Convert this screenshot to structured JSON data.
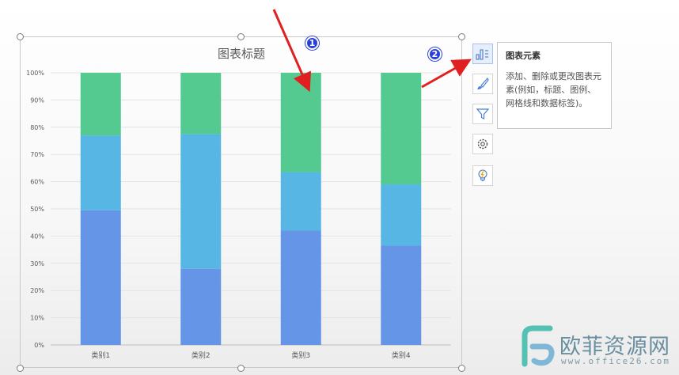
{
  "chart_data": {
    "type": "bar",
    "stacked": true,
    "percent": true,
    "title": "图表标题",
    "categories": [
      "类别1",
      "类别2",
      "类别3",
      "类别4"
    ],
    "series": [
      {
        "values": [
          49.5,
          28,
          42,
          36.5
        ],
        "color": "#6495e6"
      },
      {
        "values": [
          27.5,
          49.5,
          21.5,
          22.5
        ],
        "color": "#57b6e4"
      },
      {
        "values": [
          23,
          22.5,
          36.5,
          41
        ],
        "color": "#54c990"
      }
    ],
    "y_ticks": [
      "0%",
      "10%",
      "20%",
      "30%",
      "40%",
      "50%",
      "60%",
      "70%",
      "80%",
      "90%",
      "100%"
    ],
    "ylim": [
      0,
      100
    ],
    "grid": true,
    "legend": "none"
  },
  "side_panel": {
    "buttons": [
      {
        "icon": "chart-elements-icon",
        "active": true
      },
      {
        "icon": "brush-icon",
        "active": false
      },
      {
        "icon": "filter-icon",
        "active": false
      },
      {
        "icon": "settings-gear-icon",
        "active": false
      },
      {
        "icon": "lightbulb-icon",
        "active": false
      }
    ]
  },
  "tooltip": {
    "title": "图表元素",
    "body": "添加、删除或更改图表元素(例如，标题、图例、网格线和数据标签)。"
  },
  "annotations": {
    "badge_1": "1",
    "badge_2": "2",
    "arrow_color": "#e02020"
  },
  "watermark": {
    "text": "欧菲资源网",
    "url": "www.office26.com"
  }
}
